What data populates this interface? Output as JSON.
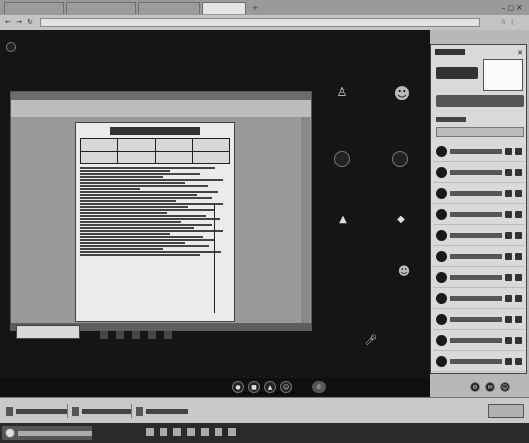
{
  "browser": {
    "tabs": [
      {
        "label": ""
      },
      {
        "label": ""
      },
      {
        "label": ""
      },
      {
        "label": ""
      }
    ],
    "address": ""
  },
  "call": {
    "title": "",
    "status": "",
    "recording_label": "",
    "tiles": [
      {
        "label": ""
      },
      {
        "label": ""
      },
      {
        "label": ""
      },
      {
        "label": ""
      },
      {
        "label": ""
      },
      {
        "label": ""
      },
      {
        "label": ""
      },
      {
        "label": ""
      }
    ],
    "bottom_left_text": "",
    "share_label": ""
  },
  "shared_document": {
    "app_title": "",
    "heading": ""
  },
  "participants_panel": {
    "title": "",
    "button_label": "",
    "search_placeholder": "",
    "section_label": "",
    "participants": [
      {
        "name": ""
      },
      {
        "name": ""
      },
      {
        "name": ""
      },
      {
        "name": ""
      },
      {
        "name": ""
      },
      {
        "name": ""
      },
      {
        "name": ""
      },
      {
        "name": ""
      },
      {
        "name": ""
      },
      {
        "name": ""
      },
      {
        "name": ""
      }
    ]
  },
  "downloads_bar": {
    "items": [
      {
        "label": ""
      },
      {
        "label": ""
      },
      {
        "label": ""
      }
    ],
    "show_all": ""
  },
  "taskbar": {
    "start_label": ""
  },
  "colors": {
    "call_bg": "#151515",
    "panel_bg": "#d9d9d9",
    "chrome_bg": "#a8a8a8",
    "taskbar_bg": "#2a2a2a"
  }
}
